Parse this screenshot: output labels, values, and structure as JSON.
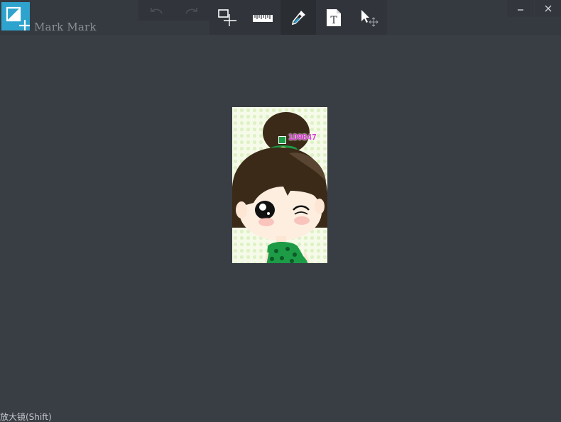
{
  "app": {
    "title": "Mark Mark"
  },
  "toolbar": {
    "undo": {
      "icon": "undo-icon"
    },
    "redo": {
      "icon": "redo-icon"
    },
    "tools": [
      {
        "icon": "rect-add-icon",
        "active": false
      },
      {
        "icon": "ruler-icon",
        "active": false
      },
      {
        "icon": "color-picker-icon",
        "active": true
      },
      {
        "icon": "text-tool-icon",
        "active": false
      },
      {
        "icon": "move-select-icon",
        "active": false
      }
    ]
  },
  "window": {
    "minimize_icon": "minimize-icon",
    "close_icon": "close-icon"
  },
  "canvas": {
    "picked_color_hex": "1D9B47",
    "picked_color": "#1d9b47"
  },
  "status": {
    "hint": "放大镜(Shift)"
  },
  "colors": {
    "background": "#393d44",
    "accent": "#2ea3cd",
    "label": "#d83ad2"
  }
}
